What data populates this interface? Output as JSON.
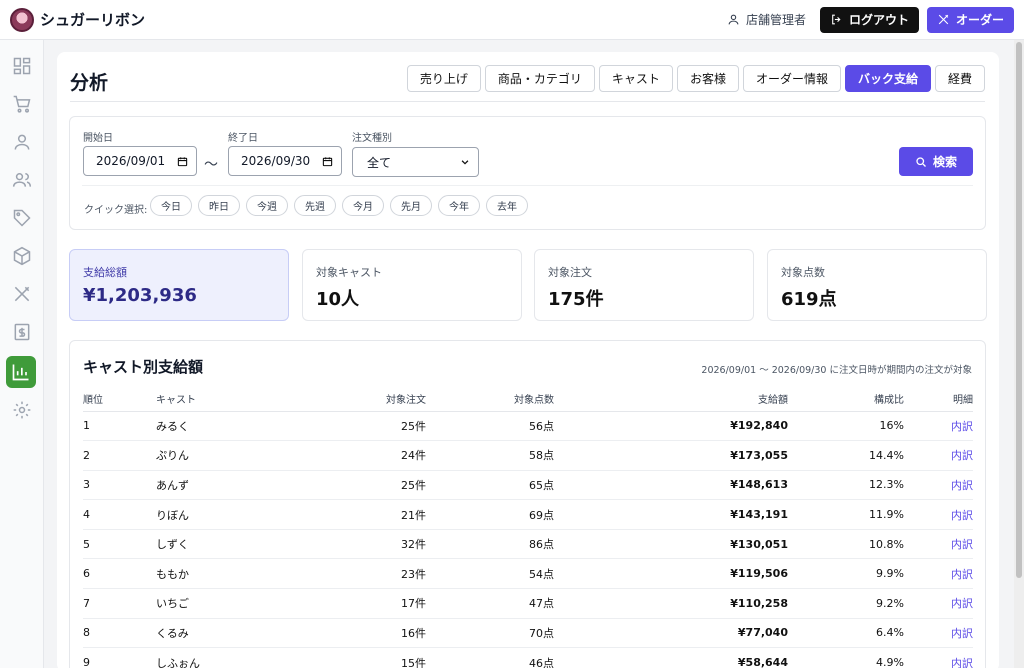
{
  "header": {
    "brand": "シュガーリボン",
    "user_label": "店舗管理者",
    "logout_label": "ログアウト",
    "order_label": "オーダー"
  },
  "sidebar": {
    "items": [
      {
        "name": "dashboard-icon",
        "active": false
      },
      {
        "name": "cart-icon",
        "active": false
      },
      {
        "name": "user-icon",
        "active": false
      },
      {
        "name": "users-icon",
        "active": false
      },
      {
        "name": "tag-icon",
        "active": false
      },
      {
        "name": "box-icon",
        "active": false
      },
      {
        "name": "utensils-icon",
        "active": false
      },
      {
        "name": "receipt-icon",
        "active": false
      },
      {
        "name": "bar-chart-icon",
        "active": true
      },
      {
        "name": "gear-icon",
        "active": false
      }
    ]
  },
  "page": {
    "title": "分析",
    "tabs": [
      {
        "label": "売り上げ",
        "active": false
      },
      {
        "label": "商品・カテゴリ",
        "active": false
      },
      {
        "label": "キャスト",
        "active": false
      },
      {
        "label": "お客様",
        "active": false
      },
      {
        "label": "オーダー情報",
        "active": false
      },
      {
        "label": "バック支給",
        "active": true
      },
      {
        "label": "経費",
        "active": false
      }
    ]
  },
  "filter": {
    "start_label": "開始日",
    "start_value": "2026/09/01",
    "end_label": "終了日",
    "end_value": "2026/09/30",
    "tilde": "〜",
    "type_label": "注文種別",
    "type_value": "全て",
    "search_label": "検索",
    "quick_label": "クイック選択:",
    "quick_options": [
      "今日",
      "昨日",
      "今週",
      "先週",
      "今月",
      "先月",
      "今年",
      "去年"
    ]
  },
  "stats": [
    {
      "label": "支給総額",
      "value": "¥1,203,936",
      "highlight": true
    },
    {
      "label": "対象キャスト",
      "value": "10人",
      "highlight": false
    },
    {
      "label": "対象注文",
      "value": "175件",
      "highlight": false
    },
    {
      "label": "対象点数",
      "value": "619点",
      "highlight": false
    }
  ],
  "table": {
    "title": "キャスト別支給額",
    "note": "2026/09/01 〜 2026/09/30 に注文日時が期間内の注文が対象",
    "columns": [
      "順位",
      "キャスト",
      "対象注文",
      "対象点数",
      "支給額",
      "構成比",
      "明細"
    ],
    "rows": [
      {
        "rank": "1",
        "cast": "みるく",
        "orders": "25件",
        "items": "56点",
        "amount": "¥192,840",
        "ratio": "16%",
        "detail": "内訳"
      },
      {
        "rank": "2",
        "cast": "ぷりん",
        "orders": "24件",
        "items": "58点",
        "amount": "¥173,055",
        "ratio": "14.4%",
        "detail": "内訳"
      },
      {
        "rank": "3",
        "cast": "あんず",
        "orders": "25件",
        "items": "65点",
        "amount": "¥148,613",
        "ratio": "12.3%",
        "detail": "内訳"
      },
      {
        "rank": "4",
        "cast": "りぼん",
        "orders": "21件",
        "items": "69点",
        "amount": "¥143,191",
        "ratio": "11.9%",
        "detail": "内訳"
      },
      {
        "rank": "5",
        "cast": "しずく",
        "orders": "32件",
        "items": "86点",
        "amount": "¥130,051",
        "ratio": "10.8%",
        "detail": "内訳"
      },
      {
        "rank": "6",
        "cast": "ももか",
        "orders": "23件",
        "items": "54点",
        "amount": "¥119,506",
        "ratio": "9.9%",
        "detail": "内訳"
      },
      {
        "rank": "7",
        "cast": "いちご",
        "orders": "17件",
        "items": "47点",
        "amount": "¥110,258",
        "ratio": "9.2%",
        "detail": "内訳"
      },
      {
        "rank": "8",
        "cast": "くるみ",
        "orders": "16件",
        "items": "70点",
        "amount": "¥77,040",
        "ratio": "6.4%",
        "detail": "内訳"
      },
      {
        "rank": "9",
        "cast": "しふぉん",
        "orders": "15件",
        "items": "46点",
        "amount": "¥58,644",
        "ratio": "4.9%",
        "detail": "内訳"
      }
    ]
  },
  "colors": {
    "accent": "#5b4be7",
    "sidebar_active": "#3f9b3a"
  }
}
